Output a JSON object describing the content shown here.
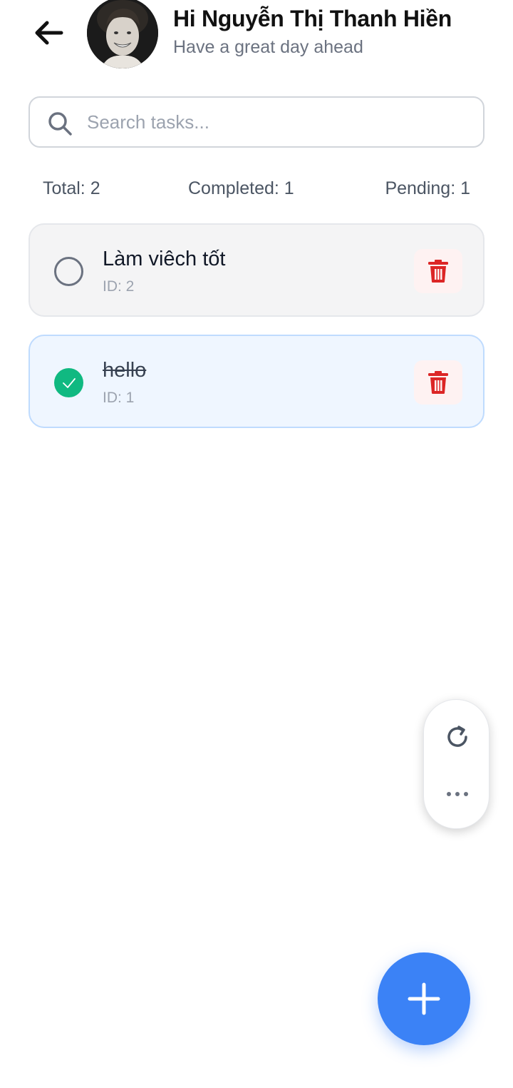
{
  "header": {
    "greeting": "Hi Nguyễn Thị Thanh Hiền",
    "subtitle": "Have a great day ahead",
    "back_icon": "arrow-left-icon",
    "avatar": "user-avatar-photo"
  },
  "search": {
    "placeholder": "Search tasks...",
    "value": "",
    "icon": "search-icon"
  },
  "stats": {
    "total": "Total: 2",
    "completed": "Completed: 1",
    "pending": "Pending: 1"
  },
  "tasks": [
    {
      "title": "Làm viêch tốt",
      "id_label": "ID: 2",
      "completed": false,
      "delete_icon": "trash-icon"
    },
    {
      "title": "hello",
      "id_label": "ID: 1",
      "completed": true,
      "delete_icon": "trash-icon"
    }
  ],
  "fab": {
    "refresh_icon": "refresh-icon",
    "more_icon": "more-horizontal-icon",
    "add_icon": "plus-icon"
  },
  "colors": {
    "primary": "#3b82f6",
    "success": "#10b981",
    "danger": "#dc2626",
    "completed_bg": "#eff6ff",
    "pending_bg": "#f4f4f5"
  }
}
